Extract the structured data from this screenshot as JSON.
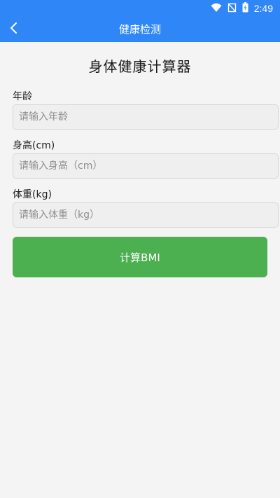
{
  "status_bar": {
    "time": "2:49",
    "icons": [
      "wifi-icon",
      "signal-off-icon",
      "battery-icon"
    ]
  },
  "app_bar": {
    "title": "健康检测",
    "back_icon": "chevron-left-icon",
    "color": "#2f86f6"
  },
  "form": {
    "title": "身体健康计算器",
    "fields": [
      {
        "label": "年龄",
        "placeholder": "请输入年龄",
        "value": ""
      },
      {
        "label": "身高(cm)",
        "placeholder": "请输入身高（cm）",
        "value": ""
      },
      {
        "label": "体重(kg)",
        "placeholder": "请输入体重（kg）",
        "value": ""
      }
    ],
    "submit_label": "计算BMI",
    "submit_color": "#4caf50"
  }
}
